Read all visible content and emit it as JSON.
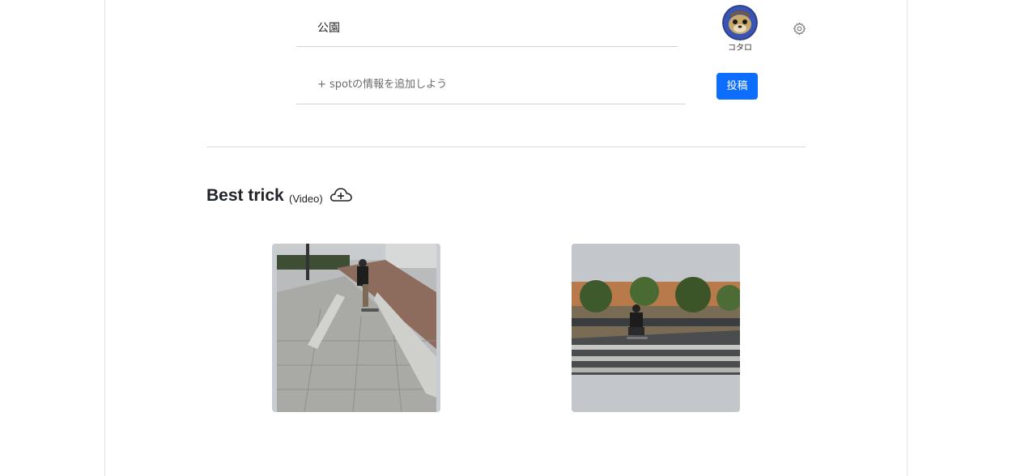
{
  "spot": {
    "name": "公園",
    "info_placeholder": "+ spotの情報を追加しよう"
  },
  "user": {
    "name": "コタロ"
  },
  "actions": {
    "post_label": "投稿"
  },
  "best_trick": {
    "title": "Best trick",
    "subtitle": "(Video)"
  },
  "icons": {
    "settings": "gear-icon",
    "upload": "cloud-plus-icon"
  },
  "colors": {
    "accent": "#0d6efd",
    "divider": "#d8d8d8",
    "video_bg": "#c3c6cb"
  }
}
